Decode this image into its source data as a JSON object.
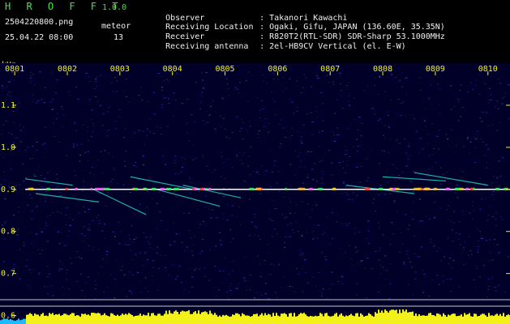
{
  "header": {
    "app_name": "H R O F F T",
    "app_version": "1.0.0",
    "filename": "2504220800.png",
    "meteor_label": "meteor",
    "datetime": "25.04.22 08:00",
    "meteor_count": "13",
    "info": [
      {
        "label": "Observer",
        "value": "Takanori Kawachi"
      },
      {
        "label": "Receiving Location",
        "value": "Ogaki, Gifu, JAPAN (136.60E, 35.35N)"
      },
      {
        "label": "Receiver",
        "value": "R820T2(RTL-SDR) SDR-Sharp 53.1000MHz"
      },
      {
        "label": "Receiving antenna",
        "value": "2el-HB9CV Vertical (el. E-W)"
      }
    ]
  },
  "colors": {
    "title": "#3fe83f",
    "axis": "#f2f21a",
    "text": "#f0f0f0",
    "background": "#000028",
    "echo_line": "#ffffff"
  },
  "chart_data": {
    "type": "heatmap",
    "y_unit_label": "kHz",
    "y_ticks": [
      "1.1",
      "1.0",
      "0.9",
      "0.8",
      "0.7",
      "0.6"
    ],
    "y_tick_values": [
      1.1,
      1.0,
      0.9,
      0.8,
      0.7,
      0.6
    ],
    "ylim": [
      0.58,
      1.2
    ],
    "x_ticks": [
      "0801",
      "0802",
      "0803",
      "0804",
      "0805",
      "0806",
      "0807",
      "0808",
      "0809",
      "0810"
    ],
    "x_tick_values": [
      1,
      2,
      3,
      4,
      5,
      6,
      7,
      8,
      9,
      10
    ],
    "xlim": [
      0.72,
      10.42
    ],
    "carrier_khz": 0.9,
    "carrier_start_min": 1.2,
    "meteor_echoes": [
      {
        "t0": 1.2,
        "t1": 2.1,
        "f0": 0.925,
        "f1": 0.91
      },
      {
        "t0": 1.4,
        "t1": 2.6,
        "f0": 0.89,
        "f1": 0.87
      },
      {
        "t0": 2.5,
        "t1": 3.5,
        "f0": 0.9,
        "f1": 0.84
      },
      {
        "t0": 3.2,
        "t1": 4.4,
        "f0": 0.93,
        "f1": 0.9
      },
      {
        "t0": 3.7,
        "t1": 4.9,
        "f0": 0.9,
        "f1": 0.86
      },
      {
        "t0": 4.2,
        "t1": 5.3,
        "f0": 0.91,
        "f1": 0.88
      },
      {
        "t0": 7.3,
        "t1": 8.6,
        "f0": 0.91,
        "f1": 0.89
      },
      {
        "t0": 8.0,
        "t1": 9.2,
        "f0": 0.93,
        "f1": 0.92
      },
      {
        "t0": 8.6,
        "t1": 10.0,
        "f0": 0.94,
        "f1": 0.91
      }
    ],
    "grid": false
  }
}
